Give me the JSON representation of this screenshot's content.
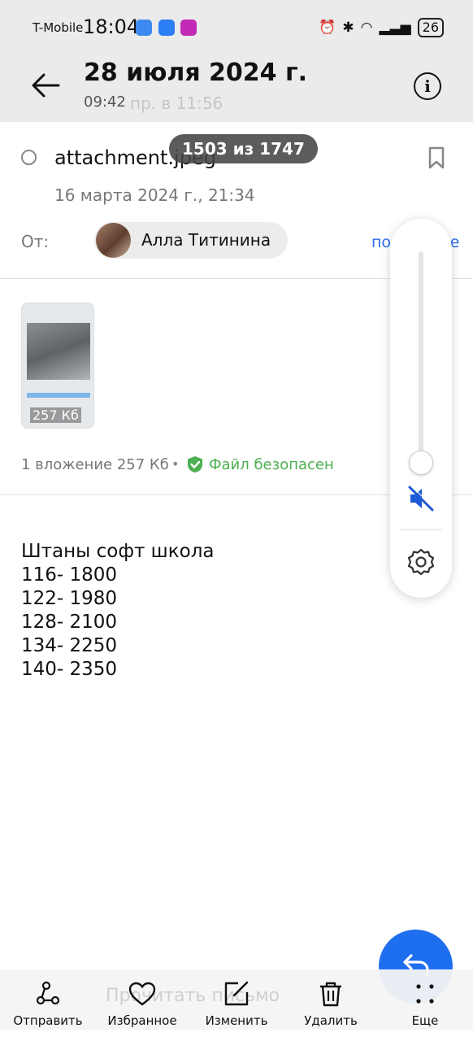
{
  "status_bar": {
    "carrier": "T-Mobile",
    "time": "18:04",
    "battery": "26"
  },
  "header": {
    "title": "28 июля 2024 г.",
    "time": "09:42",
    "background_text": "пр. в 11:56"
  },
  "counter": "1503 из 1747",
  "email": {
    "subject": "attachment.jpeg",
    "date": "16 марта 2024 г., 21:34",
    "from_label": "От:",
    "sender": "Алла Титинина",
    "details_link": "подробнее"
  },
  "attachment": {
    "size": "257 Кб",
    "summary": "1 вложение 257 Кб",
    "separator": "•",
    "safe_status": "Файл безопасен"
  },
  "body_lines": [
    "Штаны софт школа",
    "116- 1800",
    "122- 1980",
    "128- 2100",
    "134- 2250",
    "140- 2350"
  ],
  "bottom_bar": {
    "background_text": "Прочитать письмо",
    "send": "Отправить",
    "favorite": "Избранное",
    "edit": "Изменить",
    "delete": "Удалить",
    "more": "Еще"
  },
  "colors": {
    "accent": "#1e6ef0",
    "safe": "#4caf50",
    "link": "#2b6ef0",
    "mute": "#1e5ad6"
  }
}
